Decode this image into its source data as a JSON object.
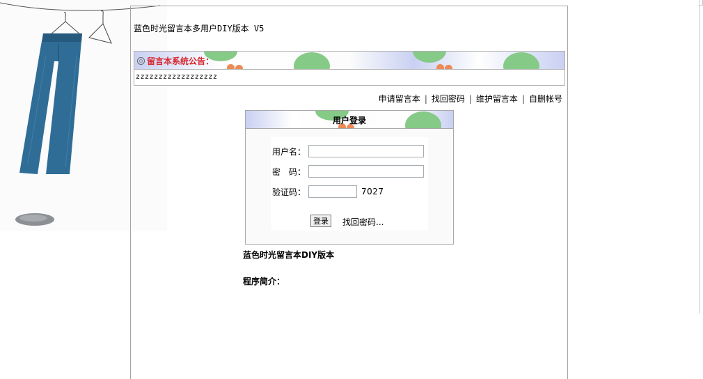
{
  "site": {
    "title": "蓝色时光留言本多用户DIY版本 V5"
  },
  "notice": {
    "title": "留言本系统公告：",
    "body": "zzzzzzzzzzzzzzzzzz"
  },
  "links": {
    "apply": "申请留言本",
    "find_password": "找回密码",
    "maintain": "维护留言本",
    "delete_account": "自删帐号",
    "separator": "|"
  },
  "login": {
    "title": "用户登录",
    "username_label": "用户名：",
    "password_label": "密　码：",
    "captcha_label": "验证码：",
    "captcha_value": "7027",
    "username_value": "",
    "password_value": "",
    "captcha_input_value": "",
    "submit_label": "登录",
    "forgot_label": "找回密码..."
  },
  "program": {
    "title": "蓝色时光留言本DIY版本",
    "intro_label": "程序简介："
  },
  "colors": {
    "notice_title": "#d7262d",
    "border": "#a5a5a5",
    "banner_blue": "#c9d0f2",
    "banner_green": "#86ca88",
    "banner_orange": "#ee8a55"
  }
}
